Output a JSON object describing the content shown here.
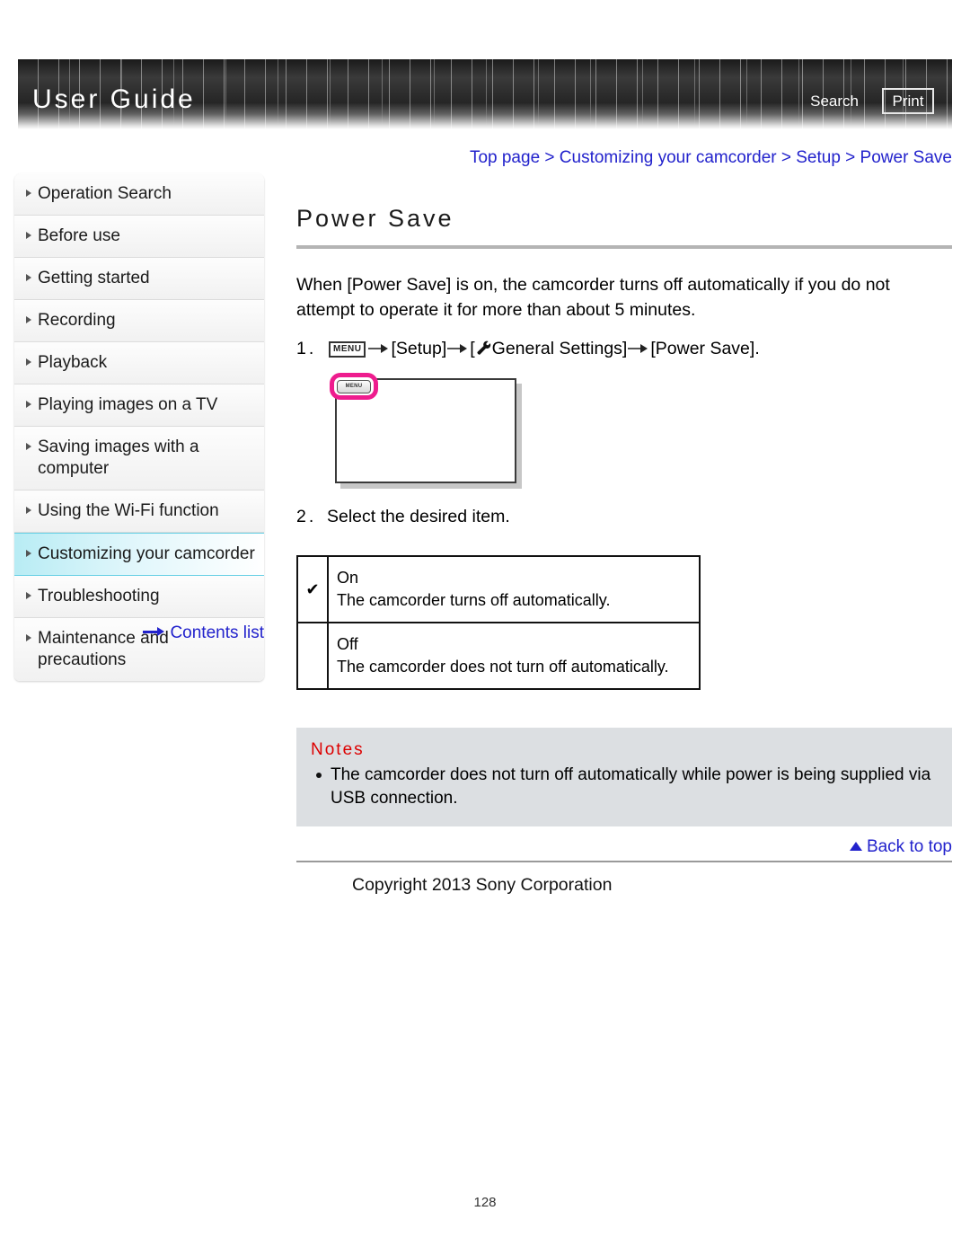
{
  "header": {
    "title": "User Guide",
    "search_label": "Search",
    "print_label": "Print"
  },
  "breadcrumb": {
    "text": "Top page > Customizing your camcorder > Setup > Power Save",
    "color": "#2222cc"
  },
  "sidebar": {
    "items": [
      {
        "label": "Operation Search",
        "active": false
      },
      {
        "label": "Before use",
        "active": false
      },
      {
        "label": "Getting started",
        "active": false
      },
      {
        "label": "Recording",
        "active": false
      },
      {
        "label": "Playback",
        "active": false
      },
      {
        "label": "Playing images on a TV",
        "active": false
      },
      {
        "label": "Saving images with a computer",
        "active": false
      },
      {
        "label": "Using the Wi-Fi function",
        "active": false
      },
      {
        "label": "Customizing your camcorder",
        "active": true
      },
      {
        "label": "Troubleshooting",
        "active": false
      },
      {
        "label": "Maintenance and precautions",
        "active": false
      }
    ],
    "contents_link": "Contents list",
    "highlight_color": "#b8ecf4"
  },
  "main": {
    "title": "Power Save",
    "intro": "When [Power Save] is on, the camcorder turns off automatically if you do not attempt to operate it for more than about 5 minutes.",
    "step1": {
      "number": "1.",
      "menu_icon_label": "MENU",
      "part_setup": "[Setup]",
      "part_general": "General Settings]",
      "part_general_open": "[",
      "part_power_save": "[Power Save].",
      "wrench_icon": "wrench-icon"
    },
    "step2": {
      "number": "2.",
      "text": "Select the desired item."
    },
    "illustration": {
      "menu_button_label": "MENU",
      "highlight_color": "#ee1c8e"
    },
    "options_table": [
      {
        "selected": true,
        "check_mark": "✔",
        "name": "On",
        "description": "The camcorder turns off automatically."
      },
      {
        "selected": false,
        "check_mark": "",
        "name": "Off",
        "description": "The camcorder does not turn off automatically."
      }
    ],
    "notes": {
      "title": "Notes",
      "title_color": "#dd0000",
      "items": [
        "The camcorder does not turn off automatically while power is being supplied via USB connection."
      ]
    }
  },
  "footer": {
    "back_to_top": "Back to top",
    "copyright": "Copyright 2013 Sony Corporation",
    "page_number": "128"
  }
}
